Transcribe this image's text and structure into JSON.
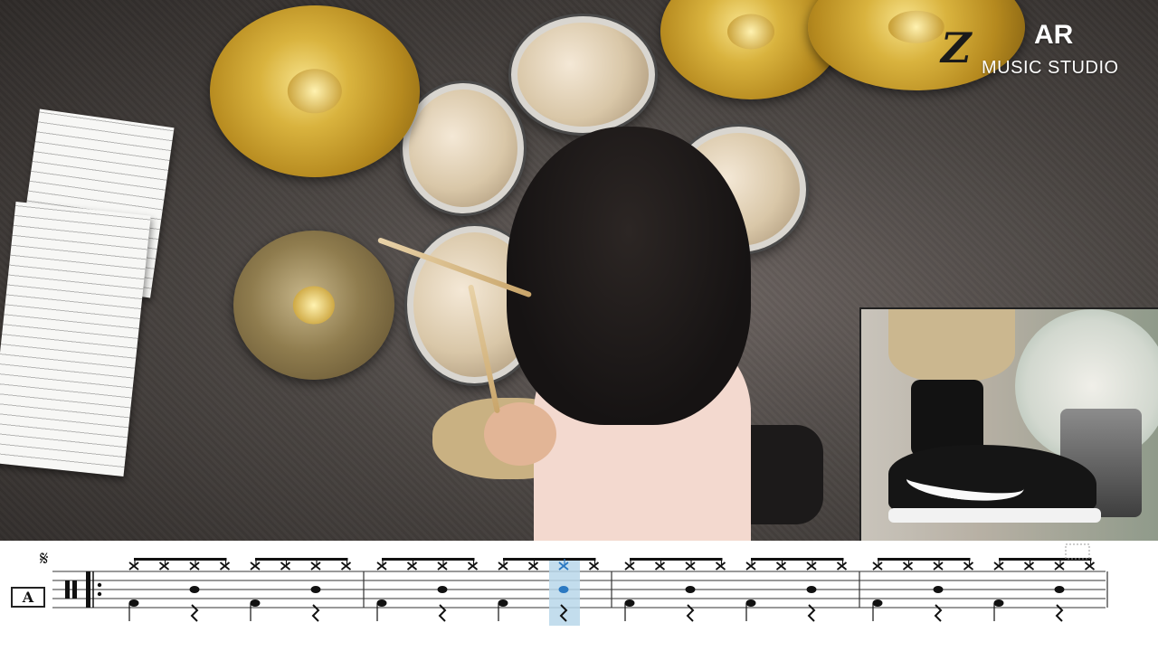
{
  "watermark": {
    "logo_letter": "Z",
    "title": "AR",
    "subtitle": "MUSIC STUDIO"
  },
  "notation": {
    "rehearsal_mark": "A",
    "segno_symbol": "𝄋",
    "measures": 4,
    "hihat_notes_per_measure": 8,
    "highlight_color": "#b9d7ea",
    "highlight_note_color": "#2b79c2",
    "current_measure": 2,
    "current_beat_eighth": 7
  },
  "colors": {
    "background_white": "#ffffff",
    "staff_line": "#333333"
  }
}
